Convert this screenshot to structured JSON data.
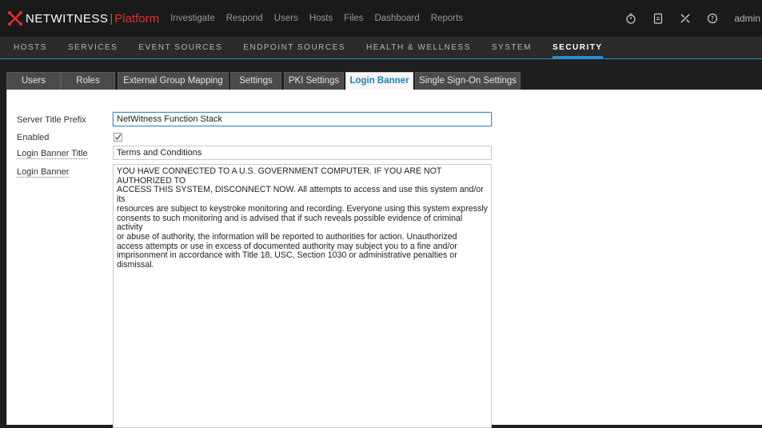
{
  "brand": {
    "name": "NETWITNESS",
    "separator": "|",
    "product": "Platform",
    "accent": "#e2322b"
  },
  "topnav": [
    "Investigate",
    "Respond",
    "Users",
    "Hosts",
    "Files",
    "Dashboard",
    "Reports"
  ],
  "topright": {
    "icons": [
      "timer-icon",
      "clipboard-icon",
      "tools-icon",
      "help-icon"
    ],
    "user": "admin"
  },
  "subnav": {
    "items": [
      "HOSTS",
      "SERVICES",
      "EVENT SOURCES",
      "ENDPOINT SOURCES",
      "HEALTH & WELLNESS",
      "SYSTEM",
      "SECURITY"
    ],
    "active": "SECURITY"
  },
  "tabs": {
    "items": [
      "Users",
      "Roles",
      "External Group Mapping",
      "Settings",
      "PKI Settings",
      "Login Banner",
      "Single Sign-On Settings"
    ],
    "active": "Login Banner"
  },
  "form": {
    "server_title_prefix_label": "Server Title Prefix",
    "server_title_prefix_value": "NetWitness Function Stack",
    "enabled_label": "Enabled",
    "enabled_checked": true,
    "login_banner_title_label": "Login Banner Title",
    "login_banner_title_value": "Terms and Conditions",
    "login_banner_label": "Login Banner",
    "login_banner_lines": [
      "YOU HAVE CONNECTED TO A U.S. GOVERNMENT COMPUTER. IF YOU ARE NOT AUTHORIZED TO",
      "ACCESS THIS SYSTEM, DISCONNECT NOW. All attempts to access and use this system and/or its",
      "resources are subject to keystroke monitoring and recording. Everyone using this system expressly",
      "consents to such monitoring and is advised that if such reveals possible evidence of criminal activity",
      "or abuse of authority, the information will be reported to authorities for action. Unauthorized",
      "access attempts or use in excess of documented authority may subject you to a fine and/or",
      "imprisonment in accordance with Title 18, USC, Section 1030 or administrative penalties or",
      "dismissal."
    ]
  }
}
